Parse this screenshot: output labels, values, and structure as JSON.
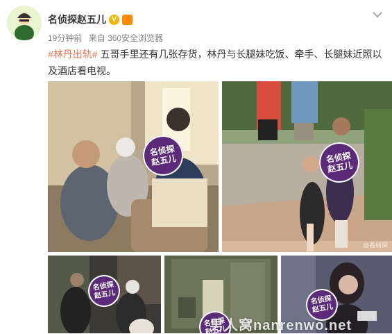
{
  "post": {
    "author": "名侦探赵五儿",
    "time": "19分钟前",
    "source": "来自 360安全浏览器",
    "topic": "#林丹出轨#",
    "body": " 五哥手里还有几张存货，林丹与长腿妹吃饭、牵手、长腿妹近照以及酒店看电视。"
  },
  "badges": {
    "verified": "V"
  },
  "watermark": {
    "circle_line1": "名侦探",
    "circle_line2": "赵五儿",
    "footer": "男人窝nanrenwo.net",
    "credit": "@名侦探"
  },
  "icons": {
    "menu": "chevron-down-icon",
    "avatar": "avatar-illustration"
  },
  "colors": {
    "accent": "#eb7350",
    "watermark": "#5b2a78",
    "verified": "#f7b500"
  }
}
